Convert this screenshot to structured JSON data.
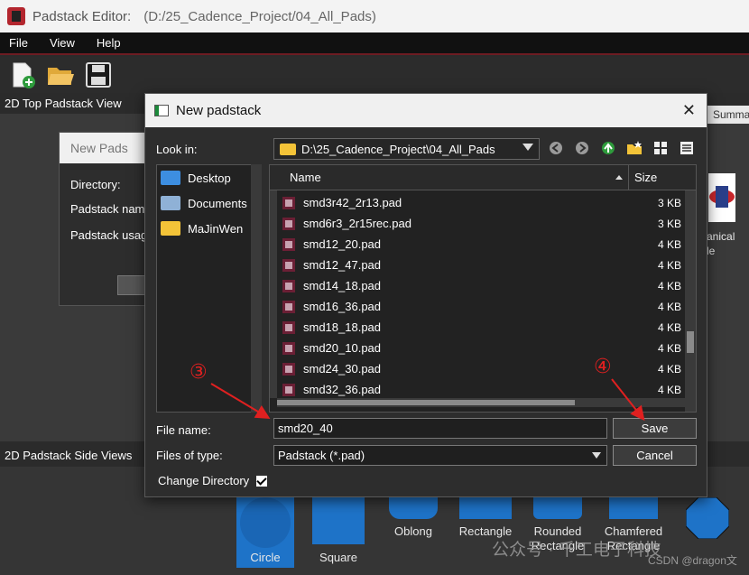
{
  "window": {
    "app_name": "Padstack Editor:",
    "path": "(D:/25_Cadence_Project/04_All_Pads)"
  },
  "menu": [
    "File",
    "View",
    "Help"
  ],
  "panes": {
    "top_title": "2D Top Padstack View",
    "side_title": "2D Padstack Side Views",
    "right_tab": "Summa"
  },
  "background_dialog": {
    "title": "New Pads",
    "labels": [
      "Directory:",
      "Padstack nam",
      "Padstack usag"
    ]
  },
  "mech_label": "anical\nle",
  "shapes": [
    {
      "label": "Circle"
    },
    {
      "label": "Square"
    },
    {
      "label": "Oblong"
    },
    {
      "label": "Rectangle"
    },
    {
      "label": "Rounded\nRectangle"
    },
    {
      "label": "Chamfered\nRectangle"
    }
  ],
  "dialog": {
    "title": "New padstack",
    "look_in_label": "Look in:",
    "look_in_value": "D:\\25_Cadence_Project\\04_All_Pads",
    "places": [
      {
        "label": "Desktop",
        "color": "#3d8ee0"
      },
      {
        "label": "Documents",
        "color": "#8fb1d6"
      },
      {
        "label": "MaJinWen",
        "color": "#f3c338"
      }
    ],
    "columns": {
      "name": "Name",
      "size": "Size"
    },
    "files": [
      {
        "name": "smd3r42_2r13.pad",
        "size": "3 KB"
      },
      {
        "name": "smd6r3_2r15rec.pad",
        "size": "3 KB"
      },
      {
        "name": "smd12_20.pad",
        "size": "4 KB"
      },
      {
        "name": "smd12_47.pad",
        "size": "4 KB"
      },
      {
        "name": "smd14_18.pad",
        "size": "4 KB"
      },
      {
        "name": "smd16_36.pad",
        "size": "4 KB"
      },
      {
        "name": "smd18_18.pad",
        "size": "4 KB"
      },
      {
        "name": "smd20_10.pad",
        "size": "4 KB"
      },
      {
        "name": "smd24_30.pad",
        "size": "4 KB"
      },
      {
        "name": "smd32_36.pad",
        "size": "4 KB"
      }
    ],
    "file_name_label": "File name:",
    "file_name_value": "smd20_40",
    "file_type_label": "Files of type:",
    "file_type_value": "Padstack (*.pad)",
    "save_label": "Save",
    "cancel_label": "Cancel",
    "change_dir_label": "Change Directory",
    "change_dir_checked": true
  },
  "annotations": {
    "step3": "③",
    "step4": "④"
  },
  "watermark": "公众号 · 千工电子科技",
  "csdn": "CSDN @dragon文"
}
